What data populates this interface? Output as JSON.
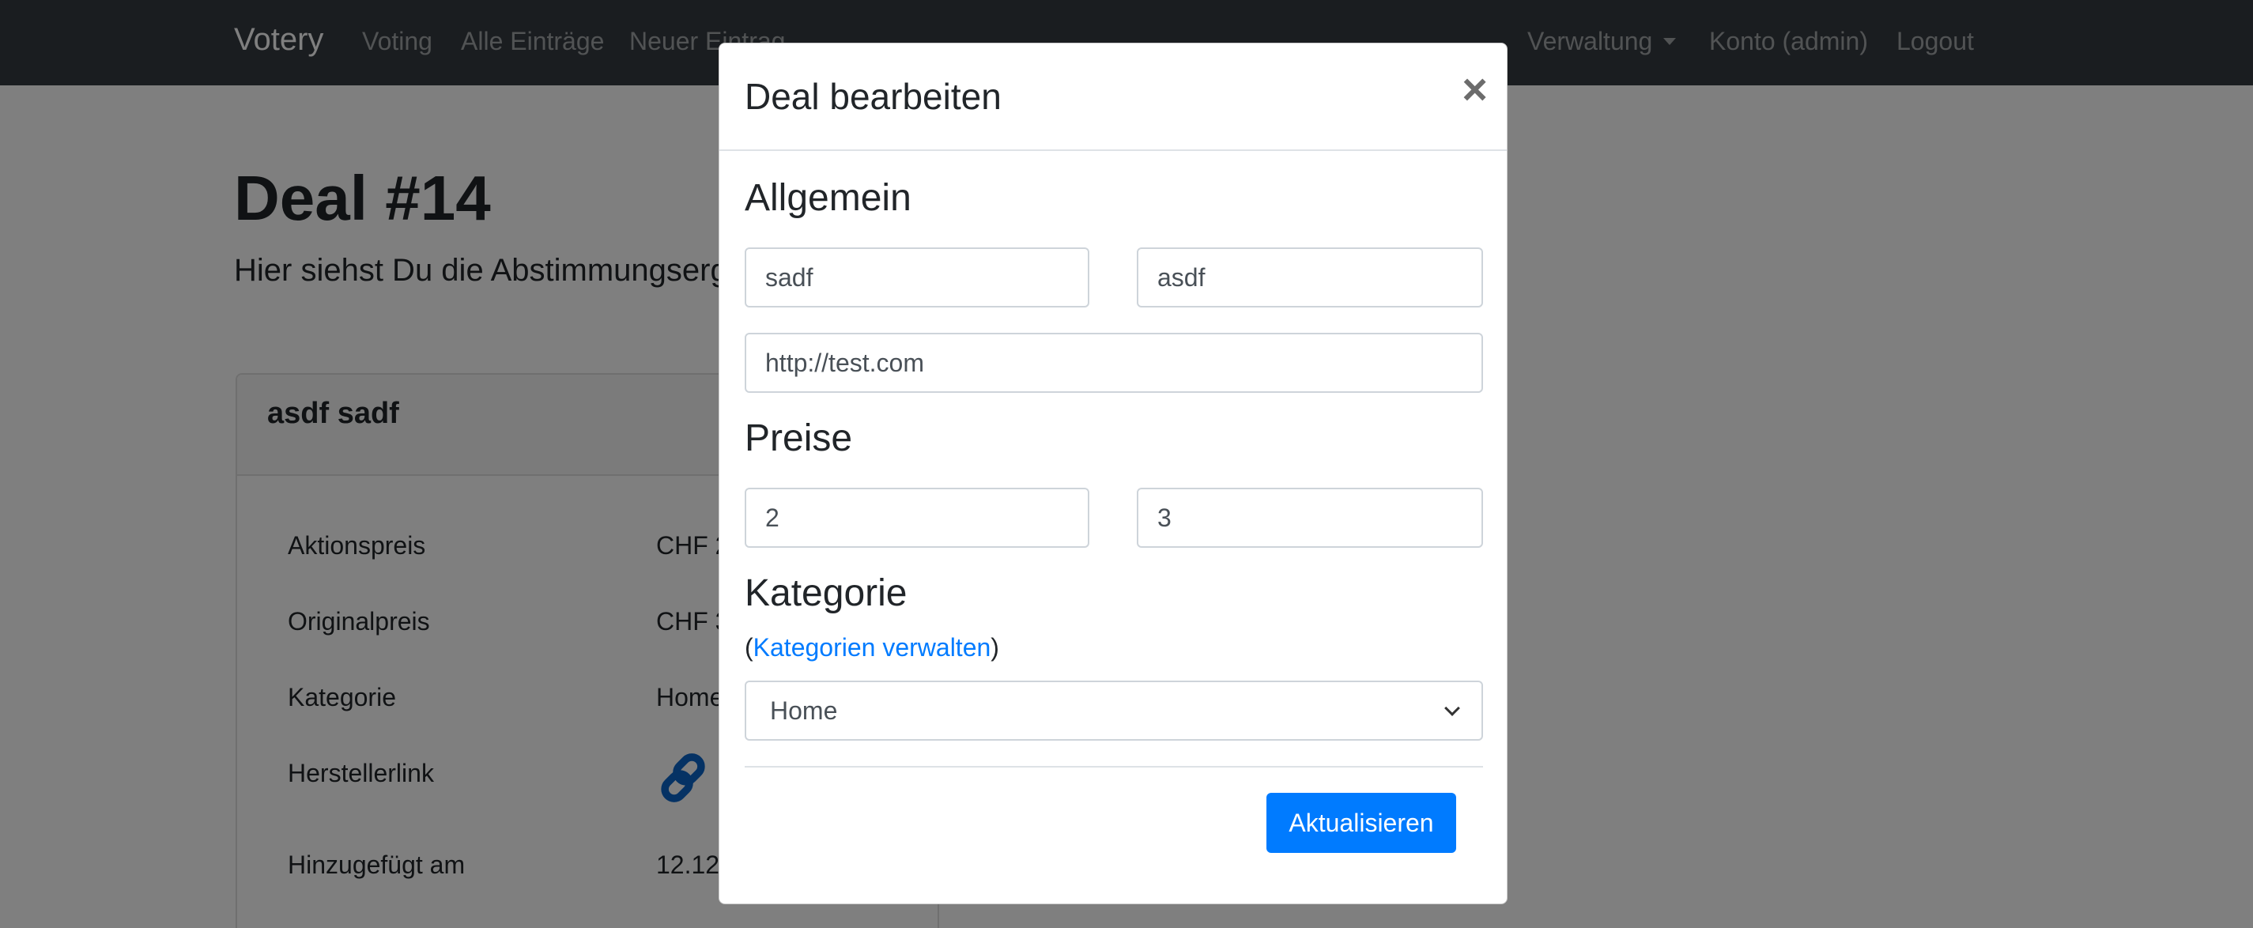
{
  "navbar": {
    "brand": "Votery",
    "links": [
      "Voting",
      "Alle Einträge",
      "Neuer Eintrag"
    ],
    "right": {
      "admin_dropdown": "Verwaltung",
      "account": "Konto (admin)",
      "logout": "Logout"
    }
  },
  "page": {
    "title": "Deal #14",
    "lead": "Hier siehst Du die Abstimmungserge",
    "card": {
      "title": "asdf sadf",
      "rows": [
        {
          "label": "Aktionspreis",
          "value": "CHF 2"
        },
        {
          "label": "Originalpreis",
          "value": "CHF 3"
        },
        {
          "label": "Kategorie",
          "value": "Home"
        },
        {
          "label": "Herstellerlink",
          "icon": "link-icon"
        },
        {
          "label": "Hinzugefügt am",
          "value": "12.12."
        }
      ]
    }
  },
  "modal": {
    "title": "Deal bearbeiten",
    "close_symbol": "×",
    "general_heading": "Allgemein",
    "field_name": "sadf",
    "field_brand": "asdf",
    "field_url": "http://test.com",
    "prices_heading": "Preise",
    "price_action": "2",
    "price_original": "3",
    "category_heading": "Kategorie",
    "category_link_prefix": "(",
    "category_link": "Kategorien verwalten",
    "category_link_suffix": ")",
    "category_selected": "Home",
    "submit_label": "Aktualisieren"
  },
  "colors": {
    "navbar": "#343a40",
    "primary": "#007bff",
    "link": "#007bff"
  }
}
